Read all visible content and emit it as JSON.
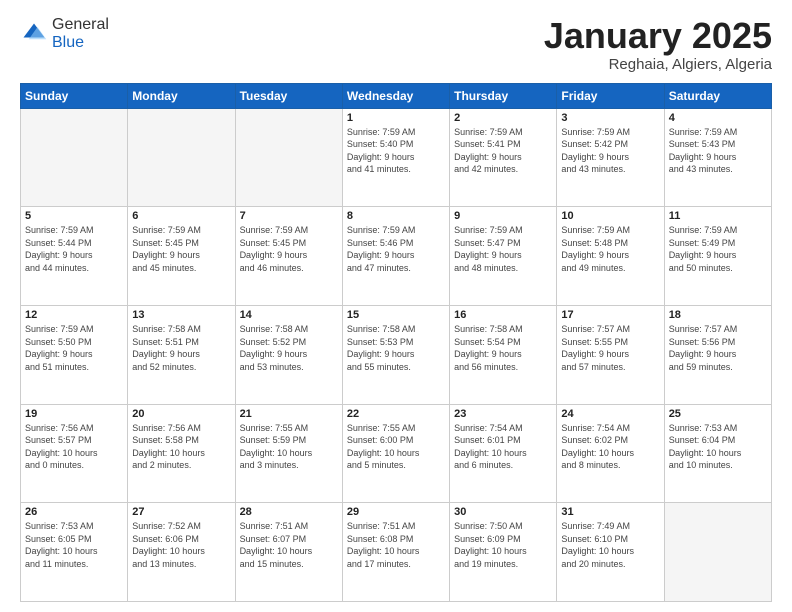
{
  "logo": {
    "general": "General",
    "blue": "Blue"
  },
  "header": {
    "title": "January 2025",
    "subtitle": "Reghaia, Algiers, Algeria"
  },
  "days_of_week": [
    "Sunday",
    "Monday",
    "Tuesday",
    "Wednesday",
    "Thursday",
    "Friday",
    "Saturday"
  ],
  "weeks": [
    [
      {
        "day": "",
        "info": ""
      },
      {
        "day": "",
        "info": ""
      },
      {
        "day": "",
        "info": ""
      },
      {
        "day": "1",
        "info": "Sunrise: 7:59 AM\nSunset: 5:40 PM\nDaylight: 9 hours\nand 41 minutes."
      },
      {
        "day": "2",
        "info": "Sunrise: 7:59 AM\nSunset: 5:41 PM\nDaylight: 9 hours\nand 42 minutes."
      },
      {
        "day": "3",
        "info": "Sunrise: 7:59 AM\nSunset: 5:42 PM\nDaylight: 9 hours\nand 43 minutes."
      },
      {
        "day": "4",
        "info": "Sunrise: 7:59 AM\nSunset: 5:43 PM\nDaylight: 9 hours\nand 43 minutes."
      }
    ],
    [
      {
        "day": "5",
        "info": "Sunrise: 7:59 AM\nSunset: 5:44 PM\nDaylight: 9 hours\nand 44 minutes."
      },
      {
        "day": "6",
        "info": "Sunrise: 7:59 AM\nSunset: 5:45 PM\nDaylight: 9 hours\nand 45 minutes."
      },
      {
        "day": "7",
        "info": "Sunrise: 7:59 AM\nSunset: 5:45 PM\nDaylight: 9 hours\nand 46 minutes."
      },
      {
        "day": "8",
        "info": "Sunrise: 7:59 AM\nSunset: 5:46 PM\nDaylight: 9 hours\nand 47 minutes."
      },
      {
        "day": "9",
        "info": "Sunrise: 7:59 AM\nSunset: 5:47 PM\nDaylight: 9 hours\nand 48 minutes."
      },
      {
        "day": "10",
        "info": "Sunrise: 7:59 AM\nSunset: 5:48 PM\nDaylight: 9 hours\nand 49 minutes."
      },
      {
        "day": "11",
        "info": "Sunrise: 7:59 AM\nSunset: 5:49 PM\nDaylight: 9 hours\nand 50 minutes."
      }
    ],
    [
      {
        "day": "12",
        "info": "Sunrise: 7:59 AM\nSunset: 5:50 PM\nDaylight: 9 hours\nand 51 minutes."
      },
      {
        "day": "13",
        "info": "Sunrise: 7:58 AM\nSunset: 5:51 PM\nDaylight: 9 hours\nand 52 minutes."
      },
      {
        "day": "14",
        "info": "Sunrise: 7:58 AM\nSunset: 5:52 PM\nDaylight: 9 hours\nand 53 minutes."
      },
      {
        "day": "15",
        "info": "Sunrise: 7:58 AM\nSunset: 5:53 PM\nDaylight: 9 hours\nand 55 minutes."
      },
      {
        "day": "16",
        "info": "Sunrise: 7:58 AM\nSunset: 5:54 PM\nDaylight: 9 hours\nand 56 minutes."
      },
      {
        "day": "17",
        "info": "Sunrise: 7:57 AM\nSunset: 5:55 PM\nDaylight: 9 hours\nand 57 minutes."
      },
      {
        "day": "18",
        "info": "Sunrise: 7:57 AM\nSunset: 5:56 PM\nDaylight: 9 hours\nand 59 minutes."
      }
    ],
    [
      {
        "day": "19",
        "info": "Sunrise: 7:56 AM\nSunset: 5:57 PM\nDaylight: 10 hours\nand 0 minutes."
      },
      {
        "day": "20",
        "info": "Sunrise: 7:56 AM\nSunset: 5:58 PM\nDaylight: 10 hours\nand 2 minutes."
      },
      {
        "day": "21",
        "info": "Sunrise: 7:55 AM\nSunset: 5:59 PM\nDaylight: 10 hours\nand 3 minutes."
      },
      {
        "day": "22",
        "info": "Sunrise: 7:55 AM\nSunset: 6:00 PM\nDaylight: 10 hours\nand 5 minutes."
      },
      {
        "day": "23",
        "info": "Sunrise: 7:54 AM\nSunset: 6:01 PM\nDaylight: 10 hours\nand 6 minutes."
      },
      {
        "day": "24",
        "info": "Sunrise: 7:54 AM\nSunset: 6:02 PM\nDaylight: 10 hours\nand 8 minutes."
      },
      {
        "day": "25",
        "info": "Sunrise: 7:53 AM\nSunset: 6:04 PM\nDaylight: 10 hours\nand 10 minutes."
      }
    ],
    [
      {
        "day": "26",
        "info": "Sunrise: 7:53 AM\nSunset: 6:05 PM\nDaylight: 10 hours\nand 11 minutes."
      },
      {
        "day": "27",
        "info": "Sunrise: 7:52 AM\nSunset: 6:06 PM\nDaylight: 10 hours\nand 13 minutes."
      },
      {
        "day": "28",
        "info": "Sunrise: 7:51 AM\nSunset: 6:07 PM\nDaylight: 10 hours\nand 15 minutes."
      },
      {
        "day": "29",
        "info": "Sunrise: 7:51 AM\nSunset: 6:08 PM\nDaylight: 10 hours\nand 17 minutes."
      },
      {
        "day": "30",
        "info": "Sunrise: 7:50 AM\nSunset: 6:09 PM\nDaylight: 10 hours\nand 19 minutes."
      },
      {
        "day": "31",
        "info": "Sunrise: 7:49 AM\nSunset: 6:10 PM\nDaylight: 10 hours\nand 20 minutes."
      },
      {
        "day": "",
        "info": ""
      }
    ]
  ]
}
